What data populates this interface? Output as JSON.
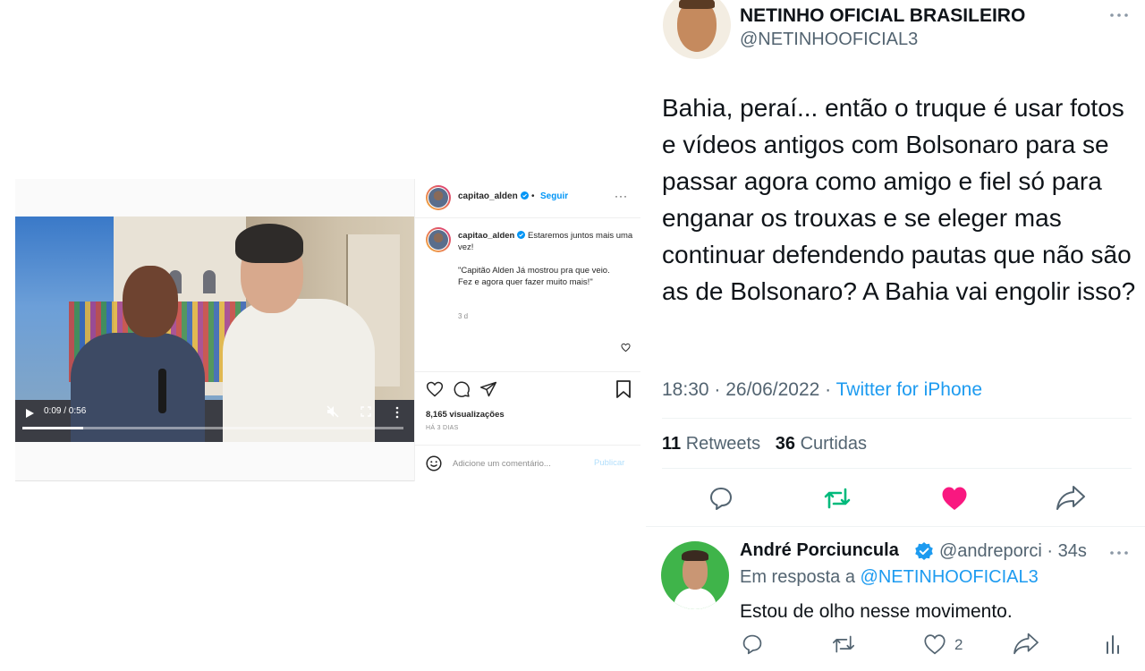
{
  "instagram": {
    "username": "capitao_alden",
    "follow_label": "Seguir",
    "separator": "•",
    "more_label": "···",
    "caption_text": "Estaremos juntos mais uma vez!",
    "caption_quote": "\"Capitão Alden Já mostrou pra que veio. Fez e agora quer fazer muito mais!\"",
    "caption_time": "3 d",
    "video_time": "0:09 / 0:56",
    "video_progress": 0.16,
    "views": "8,165 visualizações",
    "date": "HÁ 3 DIAS",
    "comment_placeholder": "Adicione um comentário...",
    "publish_label": "Publicar",
    "colors": {
      "link": "#0095f6",
      "publish_disabled": "#b2dffc"
    }
  },
  "tweet": {
    "name": "NETINHO OFICIAL BRASILEIRO",
    "handle": "@NETINHOOFICIAL3",
    "text": "Bahia, peraí... então o truque é usar fotos e vídeos antigos com Bolsonaro para se passar agora como amigo e fiel só para enganar os trouxas e se eleger mas continuar defendendo pautas que não são as de Bolsonaro? A Bahia vai engolir isso?",
    "time": "18:30 · 26/06/2022 · ",
    "source": "Twitter for iPhone",
    "retweets_count": "11",
    "retweets_label": "Retweets",
    "likes_count": "36",
    "likes_label": "Curtidas",
    "liked": true,
    "colors": {
      "link": "#1d9bf0",
      "retweet_green": "#00ba7c",
      "like_pink": "#f91880",
      "muted": "#536471"
    }
  },
  "reply": {
    "name": "André Porciuncula",
    "handle": "@andreporci · 34s",
    "context_prefix": "Em resposta a ",
    "context_mention": "@NETINHOOFICIAL3",
    "text": "Estou de olho nesse movimento.",
    "like_count": "2"
  },
  "icons": {
    "instagram": [
      "play-icon",
      "mute-icon",
      "fullscreen-icon",
      "more-vertical-icon",
      "verified-icon",
      "heart-icon",
      "comment-icon",
      "share-icon",
      "bookmark-icon",
      "emoji-icon"
    ],
    "twitter": [
      "reply-icon",
      "retweet-icon",
      "heart-filled-icon",
      "share-icon",
      "more-icon",
      "verified-icon",
      "analytics-icon"
    ]
  }
}
